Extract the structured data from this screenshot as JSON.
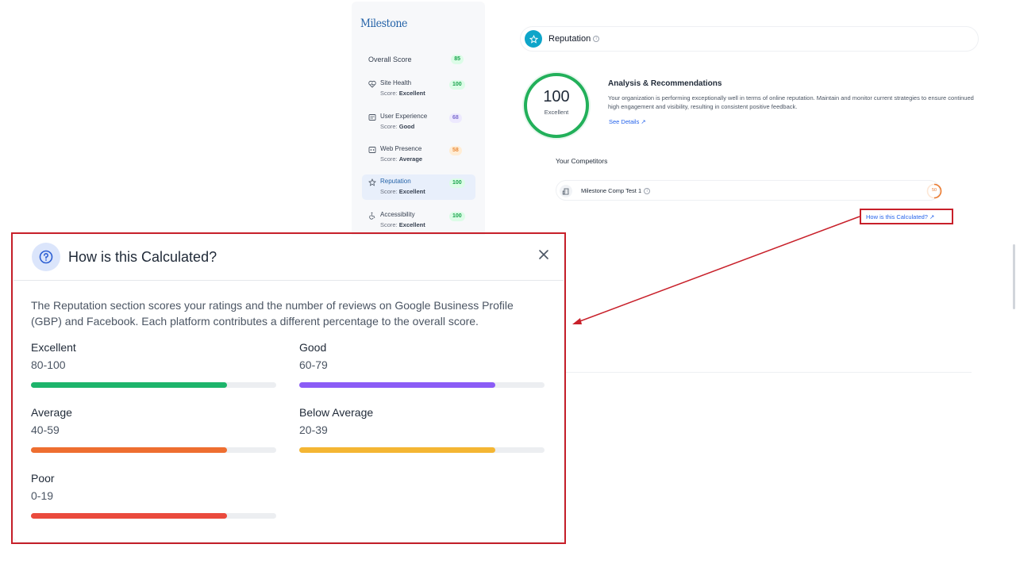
{
  "sidebar": {
    "brand": "Milestone",
    "overall_label": "Overall Score",
    "overall_score": "85",
    "score_prefix": "Score: ",
    "items": [
      {
        "label": "Site Health",
        "score": "100",
        "rating": "Excellent",
        "icon": "heart-pulse-icon",
        "active": false
      },
      {
        "label": "User Experience",
        "score": "68",
        "rating": "Good",
        "icon": "layout-icon",
        "active": false
      },
      {
        "label": "Web Presence",
        "score": "58",
        "rating": "Average",
        "icon": "browser-code-icon",
        "active": false
      },
      {
        "label": "Reputation",
        "score": "100",
        "rating": "Excellent",
        "icon": "star-icon",
        "active": true
      },
      {
        "label": "Accessibility",
        "score": "100",
        "rating": "Excellent",
        "icon": "wheelchair-icon",
        "active": false
      }
    ]
  },
  "main": {
    "section_title": "Reputation",
    "score": "100",
    "score_label": "Excellent",
    "analysis_title": "Analysis & Recommendations",
    "analysis_text": "Your organization is performing exceptionally well in terms of online reputation. Maintain and monitor current strategies to ensure continued high engagement and visibility, resulting in consistent positive feedback.",
    "see_details": "See Details ↗",
    "competitors_title": "Your Competitors",
    "competitor_name": "Milestone Comp Test 1",
    "competitor_score": "50",
    "calc_link": "How is this Calculated? ↗"
  },
  "modal": {
    "title": "How is this Calculated?",
    "description": "The Reputation section scores your ratings and the number of reviews on Google Business Profile (GBP) and Facebook. Each platform contributes a different percentage to the overall score.",
    "bands": [
      {
        "name": "Excellent",
        "range": "80-100",
        "color": "#1db46b",
        "fill": 0.8
      },
      {
        "name": "Good",
        "range": "60-79",
        "color": "#8b5cf6",
        "fill": 0.8
      },
      {
        "name": "Average",
        "range": "40-59",
        "color": "#ee6e30",
        "fill": 0.8
      },
      {
        "name": "Below Average",
        "range": "20-39",
        "color": "#f4b633",
        "fill": 0.8
      },
      {
        "name": "Poor",
        "range": "0-19",
        "color": "#ea4a3d",
        "fill": 0.8
      }
    ]
  },
  "colors": {
    "accent": "#2563eb",
    "highlight_red": "#c8202a",
    "score_green": "#22b05a",
    "reputation_badge": "#0ea5c9"
  }
}
